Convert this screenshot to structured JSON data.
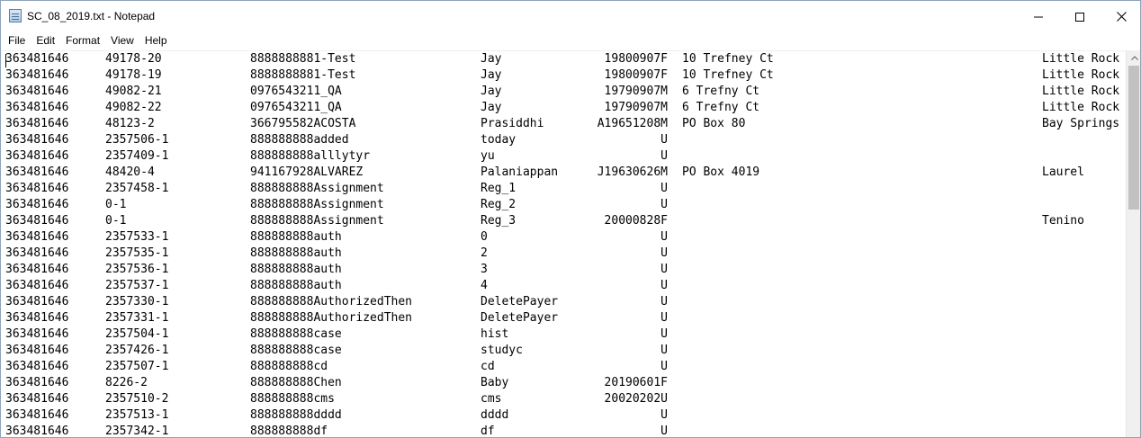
{
  "window": {
    "title": "SC_08_2019.txt - Notepad"
  },
  "menu": {
    "items": [
      "File",
      "Edit",
      "Format",
      "View",
      "Help"
    ]
  },
  "icons": {
    "app": "notepad-icon",
    "minimize": "minimize-icon",
    "maximize": "maximize-icon",
    "close": "close-icon",
    "scroll_up": "chevron-up-icon"
  },
  "lines": [
    [
      "363481646",
      "49178-20",
      "8888888881-Test",
      "Jay",
      "19800907F",
      "10 Trefney Ct",
      "Little Rock"
    ],
    [
      "363481646",
      "49178-19",
      "8888888881-Test",
      "Jay",
      "19800907F",
      "10 Trefney Ct",
      "Little Rock"
    ],
    [
      "363481646",
      "49082-21",
      "0976543211_QA",
      "Jay",
      "19790907M",
      "6 Trefny Ct",
      "Little Rock"
    ],
    [
      "363481646",
      "49082-22",
      "0976543211_QA",
      "Jay",
      "19790907M",
      "6 Trefny Ct",
      "Little Rock"
    ],
    [
      "363481646",
      "48123-2",
      "366795582ACOSTA",
      "Prasiddhi",
      "A19651208M",
      "PO Box 80",
      "Bay Springs"
    ],
    [
      "363481646",
      "2357506-1",
      "888888888added",
      "today",
      "U",
      "",
      ""
    ],
    [
      "363481646",
      "2357409-1",
      "888888888alllytyr",
      "yu",
      "U",
      "",
      ""
    ],
    [
      "363481646",
      "48420-4",
      "941167928ALVAREZ",
      "Palaniappan",
      "J19630626M",
      "PO Box 4019",
      "Laurel"
    ],
    [
      "363481646",
      "2357458-1",
      "888888888Assignment",
      "Reg_1",
      "U",
      "",
      ""
    ],
    [
      "363481646",
      "0-1",
      "888888888Assignment",
      "Reg_2",
      "U",
      "",
      ""
    ],
    [
      "363481646",
      "0-1",
      "888888888Assignment",
      "Reg_3",
      "20000828F",
      "",
      "Tenino"
    ],
    [
      "363481646",
      "2357533-1",
      "888888888auth",
      "0",
      "U",
      "",
      ""
    ],
    [
      "363481646",
      "2357535-1",
      "888888888auth",
      "2",
      "U",
      "",
      ""
    ],
    [
      "363481646",
      "2357536-1",
      "888888888auth",
      "3",
      "U",
      "",
      ""
    ],
    [
      "363481646",
      "2357537-1",
      "888888888auth",
      "4",
      "U",
      "",
      ""
    ],
    [
      "363481646",
      "2357330-1",
      "888888888AuthorizedThen",
      "DeletePayer",
      "U",
      "",
      ""
    ],
    [
      "363481646",
      "2357331-1",
      "888888888AuthorizedThen",
      "DeletePayer",
      "U",
      "",
      ""
    ],
    [
      "363481646",
      "2357504-1",
      "888888888case",
      "hist",
      "U",
      "",
      ""
    ],
    [
      "363481646",
      "2357426-1",
      "888888888case",
      "studyc",
      "U",
      "",
      ""
    ],
    [
      "363481646",
      "2357507-1",
      "888888888cd",
      "cd",
      "U",
      "",
      ""
    ],
    [
      "363481646",
      "8226-2",
      "888888888Chen",
      "Baby",
      "20190601F",
      "",
      ""
    ],
    [
      "363481646",
      "2357510-2",
      "888888888cms",
      "cms",
      "20020202U",
      "",
      ""
    ],
    [
      "363481646",
      "2357513-1",
      "888888888dddd",
      "dddd",
      "U",
      "",
      ""
    ],
    [
      "363481646",
      "2357342-1",
      "888888888df",
      "df",
      "U",
      "",
      ""
    ]
  ]
}
